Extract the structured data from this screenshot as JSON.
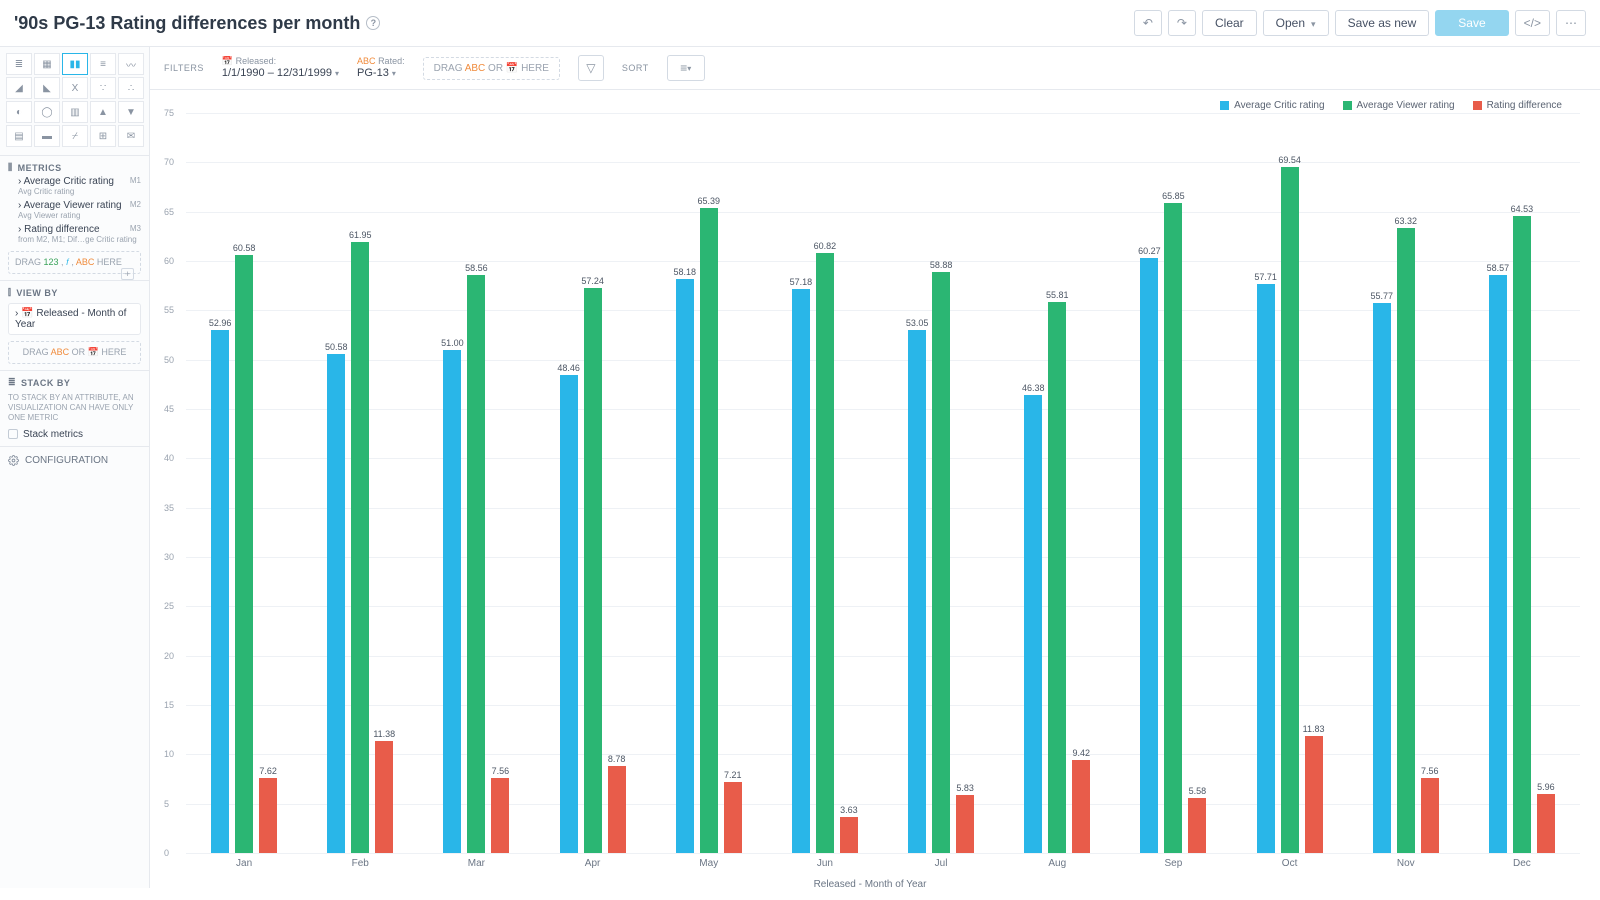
{
  "header": {
    "title": "'90s PG-13 Rating differences per month",
    "undo": "↶",
    "redo": "↷",
    "clear": "Clear",
    "open": "Open",
    "save_as_new": "Save as new",
    "save": "Save",
    "embed": "</>",
    "more": "⋯"
  },
  "sidebar": {
    "metrics_h": "METRICS",
    "metrics": [
      {
        "name": "Average Critic rating",
        "sub": "Avg Critic rating",
        "badge": "M1"
      },
      {
        "name": "Average Viewer rating",
        "sub": "Avg Viewer rating",
        "badge": "M2"
      },
      {
        "name": "Rating difference",
        "sub": "from M2, M1; Dif…ge Critic rating",
        "badge": "M3"
      }
    ],
    "metric_drop": "DRAG 123 , 𝑓 , ABC HERE",
    "viewby_h": "VIEW BY",
    "viewby_item": "Released - Month of Year",
    "viewby_drop": "DRAG ABC OR 📅 HERE",
    "stackby_h": "STACK BY",
    "stack_note": "TO STACK BY AN ATTRIBUTE, AN VISUALIZATION CAN HAVE ONLY ONE METRIC",
    "stack_metrics": "Stack metrics",
    "configuration": "CONFIGURATION"
  },
  "filters": {
    "label": "FILTERS",
    "f1_t": "Released:",
    "f1_v": "1/1/1990 – 12/31/1999",
    "f2_pre": "ABC",
    "f2_t": "Rated:",
    "f2_v": "PG-13",
    "drop": "DRAG ABC OR 📅 HERE",
    "sort": "SORT"
  },
  "legend": {
    "s1": "Average Critic rating",
    "s2": "Average Viewer rating",
    "s3": "Rating difference"
  },
  "colors": {
    "blue": "#29b6e8",
    "green": "#2bb673",
    "red": "#e85c4a"
  },
  "chart_data": {
    "type": "bar",
    "title": "",
    "xlabel": "Released - Month of Year",
    "ylabel": "",
    "ylim": [
      0,
      75
    ],
    "yticks": [
      0,
      5,
      10,
      15,
      20,
      25,
      30,
      35,
      40,
      45,
      50,
      55,
      60,
      65,
      70,
      75
    ],
    "categories": [
      "Jan",
      "Feb",
      "Mar",
      "Apr",
      "May",
      "Jun",
      "Jul",
      "Aug",
      "Sep",
      "Oct",
      "Nov",
      "Dec"
    ],
    "series": [
      {
        "name": "Average Critic rating",
        "color": "#29b6e8",
        "values": [
          52.96,
          50.58,
          51.0,
          48.46,
          58.18,
          57.18,
          53.05,
          46.38,
          60.27,
          57.71,
          55.77,
          58.57
        ]
      },
      {
        "name": "Average Viewer rating",
        "color": "#2bb673",
        "values": [
          60.58,
          61.95,
          58.56,
          57.24,
          65.39,
          60.82,
          58.88,
          55.81,
          65.85,
          69.54,
          63.32,
          64.53
        ]
      },
      {
        "name": "Rating difference",
        "color": "#e85c4a",
        "values": [
          7.62,
          11.38,
          7.56,
          8.78,
          7.21,
          3.63,
          5.83,
          9.42,
          5.58,
          11.83,
          7.56,
          5.96
        ]
      }
    ]
  }
}
